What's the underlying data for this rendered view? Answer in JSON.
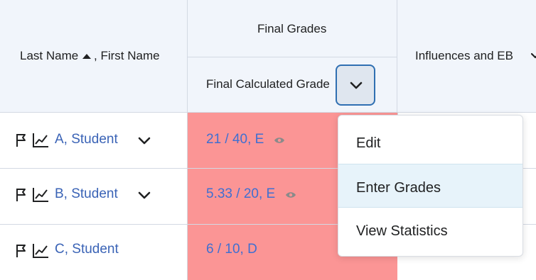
{
  "header": {
    "name_column": "Last Name",
    "name_column_suffix": ", First Name",
    "final_grades": "Final Grades",
    "final_calculated_grade": "Final Calculated Grade",
    "influences": "Influences and EB"
  },
  "rows": [
    {
      "name": "A, Student",
      "grade": "21 / 40, E"
    },
    {
      "name": "B, Student",
      "grade": "5.33 / 20, E"
    },
    {
      "name": "C, Student",
      "grade": "6 / 10, D"
    }
  ],
  "menu": {
    "items": [
      "Edit",
      "Enter Grades",
      "View Statistics"
    ]
  },
  "colors": {
    "header_bg": "#f1f5fb",
    "grade_bg": "#fb9595",
    "link": "#3a63b6",
    "focus": "#2f6fb2"
  }
}
